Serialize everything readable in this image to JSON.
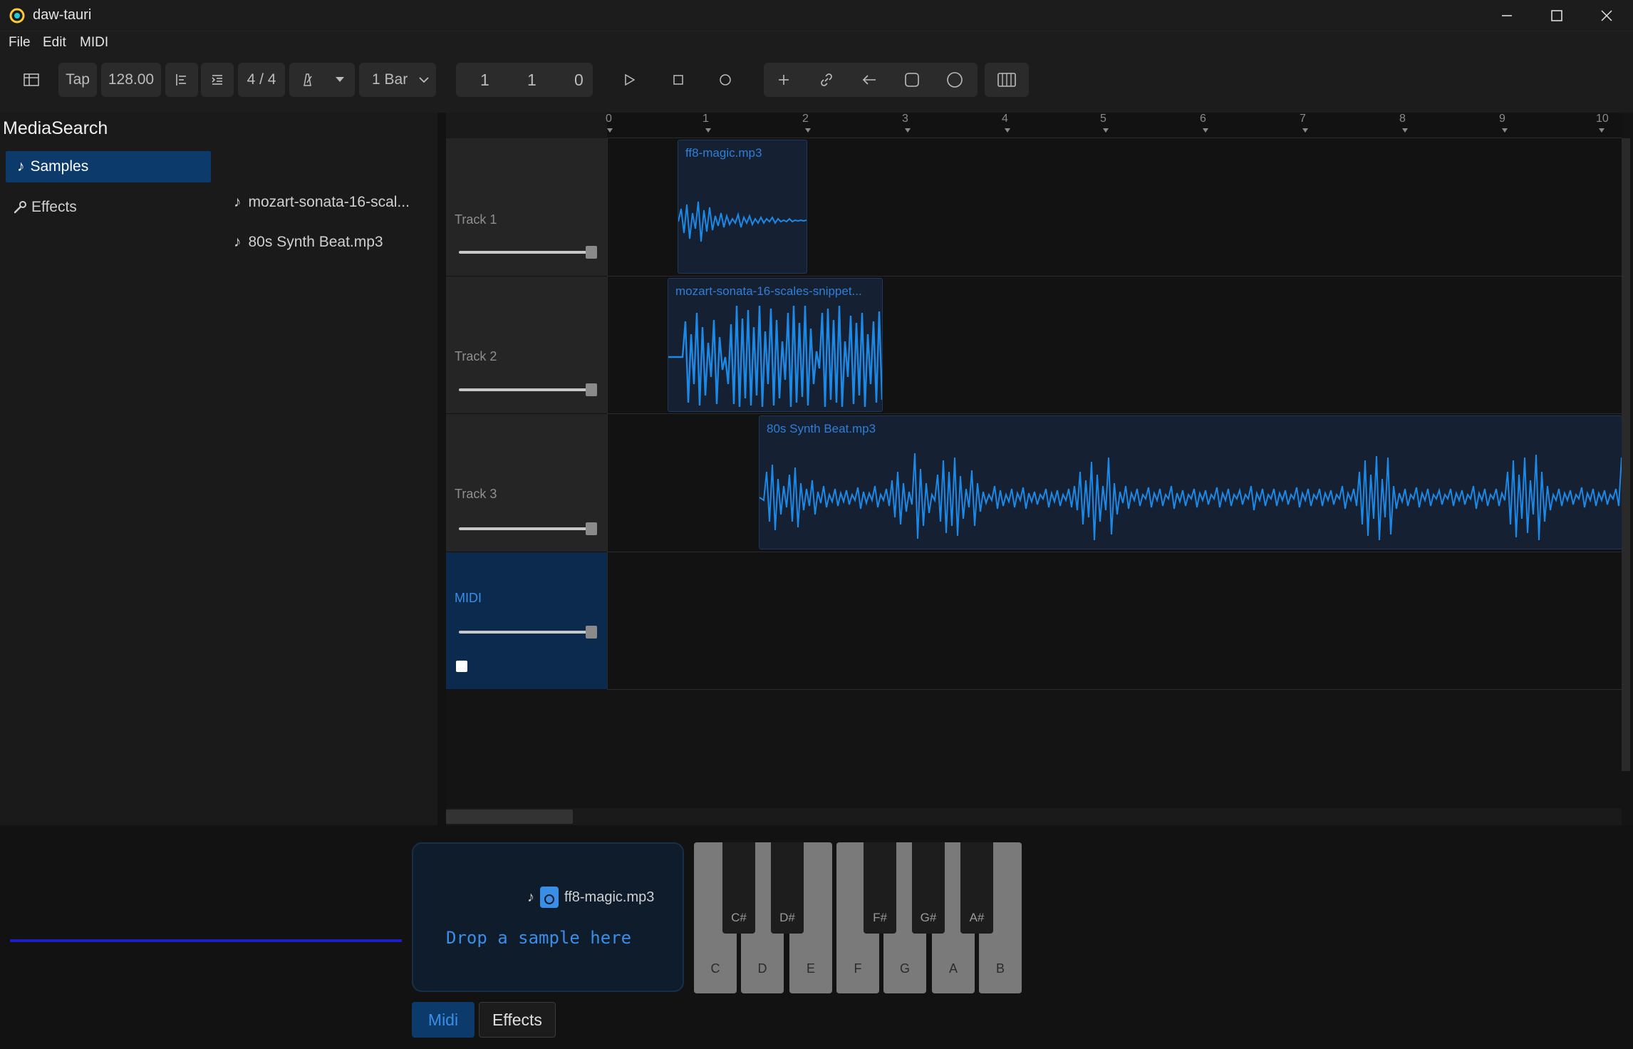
{
  "window": {
    "title": "daw-tauri"
  },
  "menu": {
    "items": [
      "File",
      "Edit",
      "MIDI"
    ]
  },
  "toolbar": {
    "tap_label": "Tap",
    "bpm": "128.00",
    "time_signature": "4 / 4",
    "grid_label": "1 Bar",
    "position": {
      "bar": "1",
      "beat": "1",
      "tick": "0"
    }
  },
  "left_panel": {
    "title": "MediaSearch",
    "nav": [
      {
        "label": "Samples",
        "icon": "music-note-icon",
        "active": true
      },
      {
        "label": "Effects",
        "icon": "wrench-icon"
      }
    ],
    "samples": [
      "mozart-sonata-16-scal...",
      "80s Synth Beat.mp3"
    ]
  },
  "ruler": {
    "ticks": [
      "0",
      "1",
      "2",
      "3",
      "4",
      "5",
      "6",
      "7",
      "8",
      "9",
      "10"
    ]
  },
  "tracks": [
    {
      "name": "Track 1",
      "clip": "ff8-magic.mp3"
    },
    {
      "name": "Track 2",
      "clip": "mozart-sonata-16-scales-snippet..."
    },
    {
      "name": "Track 3",
      "clip": "80s Synth Beat.mp3"
    },
    {
      "name": "MIDI"
    }
  ],
  "sampler": {
    "file": "ff8-magic.mp3",
    "drop_text": "Drop a sample here"
  },
  "piano": {
    "white_keys": [
      "C",
      "D",
      "E",
      "F",
      "G",
      "A",
      "B"
    ],
    "black_keys": [
      "C#",
      "D#",
      "F#",
      "G#",
      "A#"
    ]
  },
  "bottom_tabs": [
    "Midi",
    "Effects"
  ],
  "colors": {
    "accent": "#2f7fd6",
    "selection": "#0b3a6b",
    "waveform": "#1e88e5"
  }
}
